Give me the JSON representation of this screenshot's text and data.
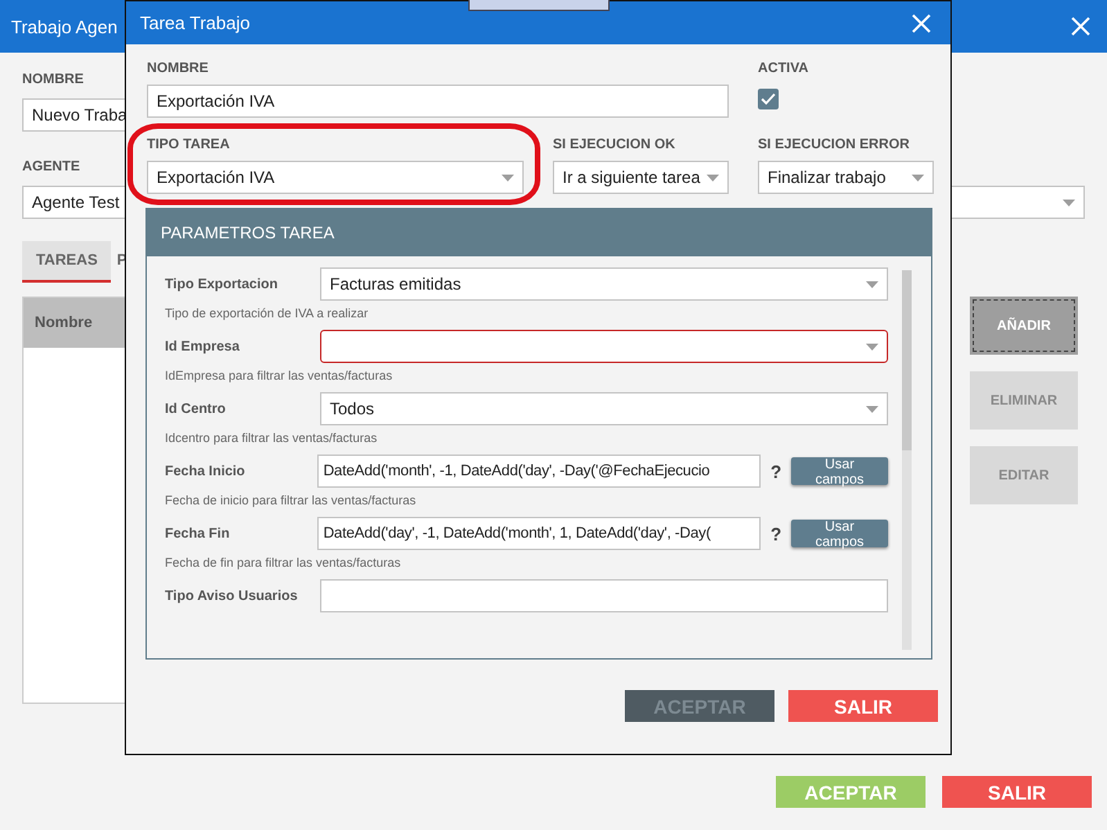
{
  "main_window": {
    "title": "Trabajo Agen",
    "name_label": "NOMBRE",
    "name_value": "Nuevo Traba",
    "agent_label": "AGENTE",
    "agent_value": "Agente Test",
    "tabs": [
      {
        "label": "TAREAS",
        "selected": true
      },
      {
        "label": "P",
        "selected": false
      }
    ],
    "table": {
      "columns": [
        "Nombre"
      ]
    },
    "side_buttons": [
      {
        "label": "AÑADIR",
        "disabled": false,
        "focused": true
      },
      {
        "label": "ELIMINAR",
        "disabled": true,
        "focused": false
      },
      {
        "label": "EDITAR",
        "disabled": true,
        "focused": false
      }
    ],
    "buttons": [
      {
        "label": "ACEPTAR",
        "kind": "accept",
        "disabled": false
      },
      {
        "label": "SALIR",
        "kind": "cancel",
        "disabled": false
      }
    ]
  },
  "dialog": {
    "title": "Tarea Trabajo",
    "name_label": "NOMBRE",
    "name_value": "Exportación IVA",
    "active_label": "ACTIVA",
    "active": true,
    "selects": [
      {
        "label": "TIPO TAREA",
        "value": "Exportación IVA",
        "highlighted": true
      },
      {
        "label": "SI EJECUCION OK",
        "value": "Ir a siguiente tarea",
        "highlighted": false
      },
      {
        "label": "SI EJECUCION ERROR",
        "value": "Finalizar trabajo",
        "highlighted": false
      }
    ],
    "params": {
      "title": "PARAMETROS TAREA",
      "rows": [
        {
          "kind": "select",
          "label": "Tipo Exportacion",
          "value": "Facturas emitidas",
          "hint": "Tipo de exportación de IVA a realizar",
          "invalid": false
        },
        {
          "kind": "select",
          "label": "Id Empresa",
          "hint": "IdEmpresa para filtrar las ventas/facturas",
          "invalid": true
        },
        {
          "kind": "select",
          "label": "Id Centro",
          "value": "Todos",
          "hint": "Idcentro para filtrar las ventas/facturas",
          "invalid": false
        },
        {
          "kind": "expression",
          "label": "Fecha Inicio",
          "value": "DateAdd('month', -1, DateAdd('day', -Day('@FechaEjecucio",
          "help": "?",
          "action": "Usar campos",
          "hint": "Fecha de inicio para filtrar las ventas/facturas",
          "invalid": false
        },
        {
          "kind": "expression",
          "label": "Fecha Fin",
          "value": "DateAdd('day', -1, DateAdd('month', 1, DateAdd('day', -Day(",
          "help": "?",
          "action": "Usar campos",
          "hint": "Fecha de fin para filtrar las ventas/facturas",
          "invalid": false
        },
        {
          "kind": "text",
          "label": "Tipo Aviso Usuarios",
          "invalid": false
        }
      ]
    },
    "buttons": [
      {
        "label": "ACEPTAR",
        "kind": "accept",
        "disabled": true
      },
      {
        "label": "SALIR",
        "kind": "cancel",
        "disabled": false
      }
    ]
  }
}
